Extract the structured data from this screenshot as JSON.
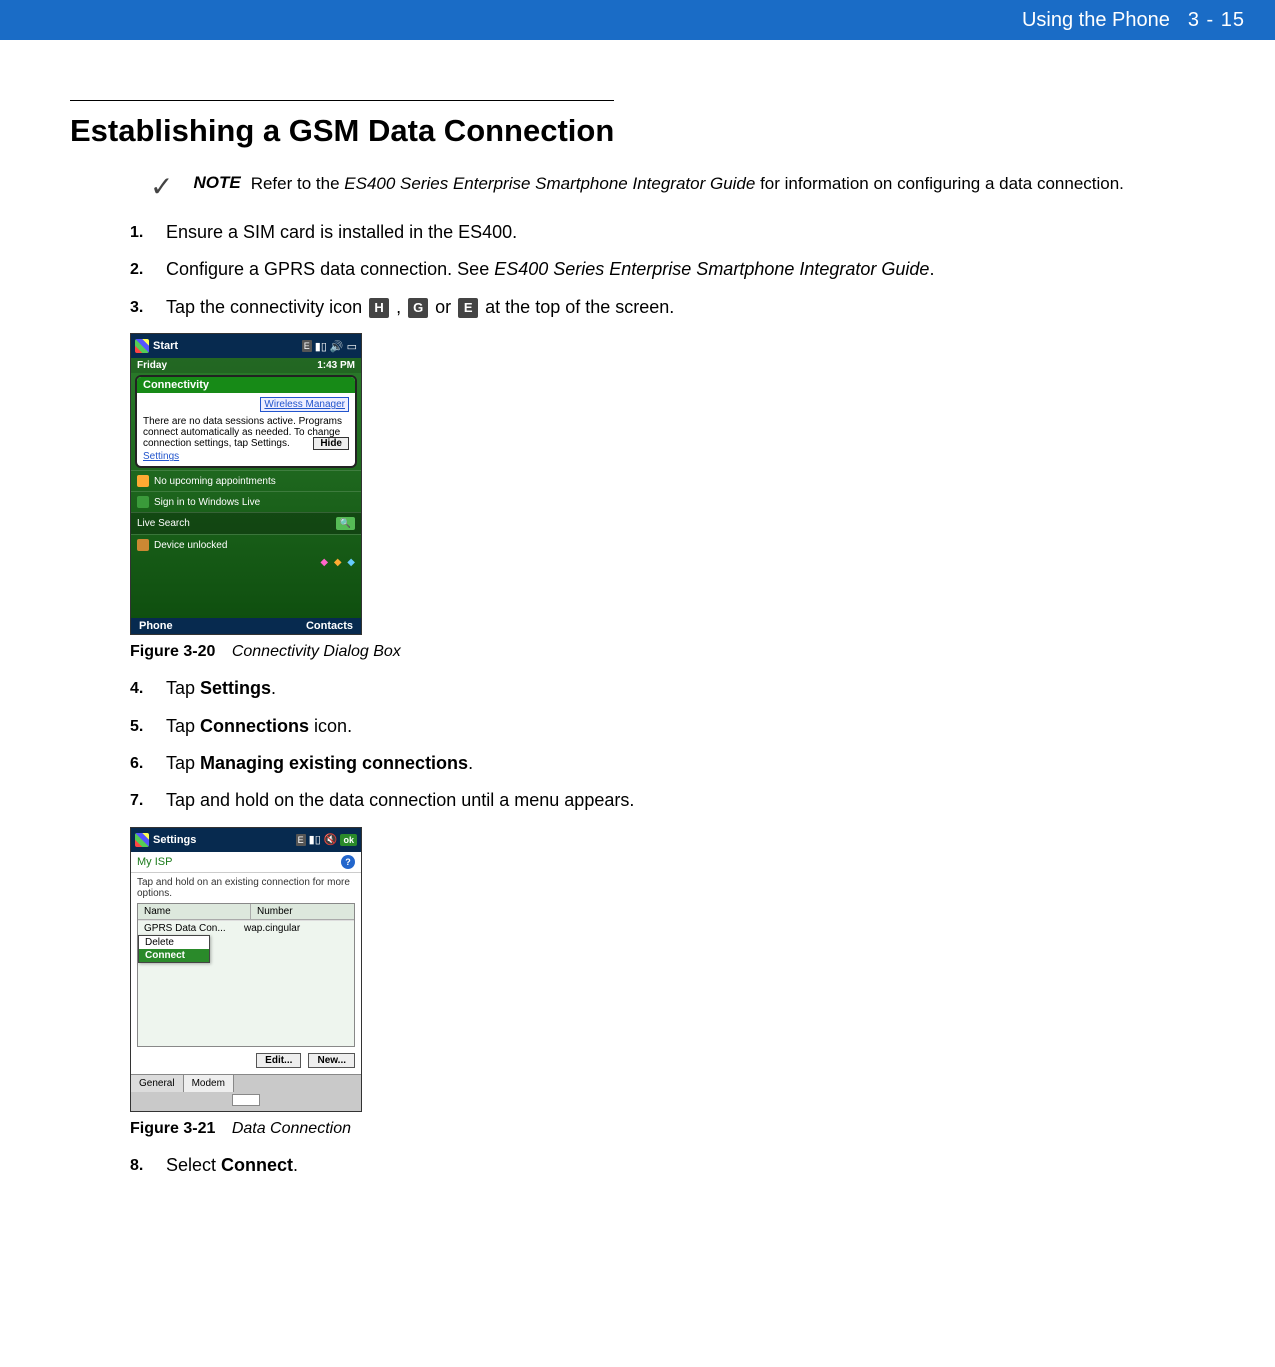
{
  "header": {
    "title": "Using the Phone",
    "page": "3 - 15"
  },
  "section_title": "Establishing a GSM Data Connection",
  "note": {
    "label": "NOTE",
    "pre": "Refer to the ",
    "italic": "ES400 Series Enterprise Smartphone Integrator Guide",
    "post": " for information on configuring a data connection."
  },
  "steps": {
    "s1": {
      "num": "1.",
      "text": "Ensure a SIM card is installed in the ES400."
    },
    "s2": {
      "num": "2.",
      "pre": "Configure a GPRS data connection. See ",
      "italic": "ES400 Series Enterprise Smartphone Integrator Guide",
      "post": "."
    },
    "s3": {
      "num": "3.",
      "pre": "Tap the connectivity icon ",
      "h": "H",
      "sep1": " , ",
      "g": "G",
      "sep2": " or ",
      "e": "E",
      "post": " at the top of the screen."
    },
    "s4": {
      "num": "4.",
      "pre": "Tap ",
      "bold": "Settings",
      "post": "."
    },
    "s5": {
      "num": "5.",
      "pre": "Tap ",
      "bold": "Connections",
      "post": " icon."
    },
    "s6": {
      "num": "6.",
      "pre": "Tap ",
      "bold": "Managing existing connections",
      "post": "."
    },
    "s7": {
      "num": "7.",
      "text": "Tap and hold on the data connection until a menu appears."
    },
    "s8": {
      "num": "8.",
      "pre": "Select ",
      "bold": "Connect",
      "post": "."
    }
  },
  "fig20": {
    "label": "Figure 3-20",
    "title": "Connectivity Dialog Box",
    "shot": {
      "title": "Start",
      "status_e": "E",
      "day": "Friday",
      "time": "1:43 PM",
      "bubble_title": "Connectivity",
      "wireless_manager": "Wireless Manager",
      "body": "There are no data sessions active. Programs connect automatically as needed. To change connection settings, tap Settings.",
      "settings_link": "Settings",
      "hide": "Hide",
      "row_appts": "No upcoming appointments",
      "row_live": "Sign in to Windows Live",
      "row_search": "Live Search",
      "row_unlocked": "Device unlocked",
      "sk_left": "Phone",
      "sk_right": "Contacts"
    }
  },
  "fig21": {
    "label": "Figure 3-21",
    "title": "Data Connection",
    "shot": {
      "title": "Settings",
      "status_e": "E",
      "ok": "ok",
      "myisp": "My ISP",
      "hint": "Tap and hold on an existing connection for more options.",
      "th_name": "Name",
      "th_number": "Number",
      "row_name": "GPRS Data Con...",
      "row_number": "wap.cingular",
      "menu_delete": "Delete",
      "menu_connect": "Connect",
      "btn_edit": "Edit...",
      "btn_new": "New...",
      "tab_general": "General",
      "tab_modem": "Modem"
    }
  }
}
